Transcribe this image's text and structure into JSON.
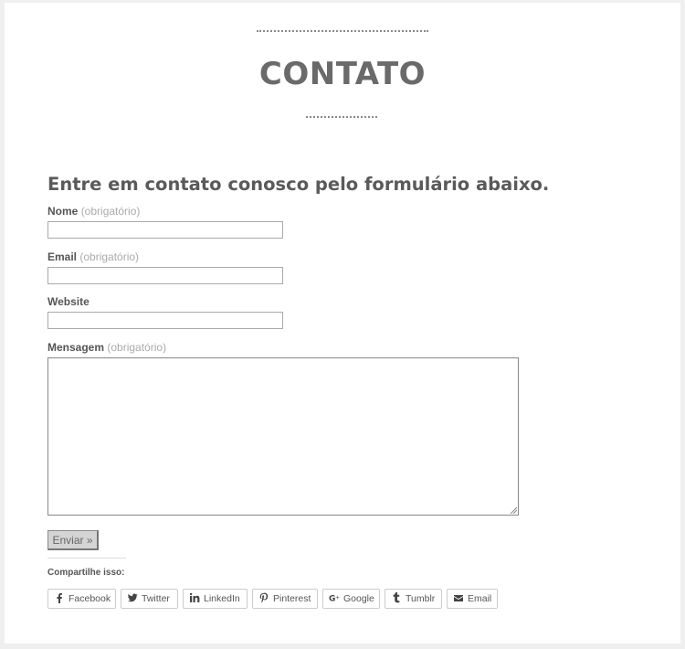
{
  "header": {
    "title": "CONTATO"
  },
  "form": {
    "intro": "Entre em contato conosco pelo formulário abaixo.",
    "fields": {
      "name": {
        "label": "Nome",
        "required_note": "(obrigatório)",
        "value": ""
      },
      "email": {
        "label": "Email",
        "required_note": "(obrigatório)",
        "value": ""
      },
      "website": {
        "label": "Website",
        "value": ""
      },
      "message": {
        "label": "Mensagem",
        "required_note": "(obrigatório)",
        "value": ""
      }
    },
    "submit_label": "Enviar »"
  },
  "share": {
    "title": "Compartilhe isso:",
    "buttons": [
      {
        "label": "Facebook",
        "icon": "facebook-icon"
      },
      {
        "label": "Twitter",
        "icon": "twitter-icon"
      },
      {
        "label": "LinkedIn",
        "icon": "linkedin-icon"
      },
      {
        "label": "Pinterest",
        "icon": "pinterest-icon"
      },
      {
        "label": "Google",
        "icon": "google-plus-icon"
      },
      {
        "label": "Tumblr",
        "icon": "tumblr-icon"
      },
      {
        "label": "Email",
        "icon": "email-icon"
      }
    ]
  }
}
